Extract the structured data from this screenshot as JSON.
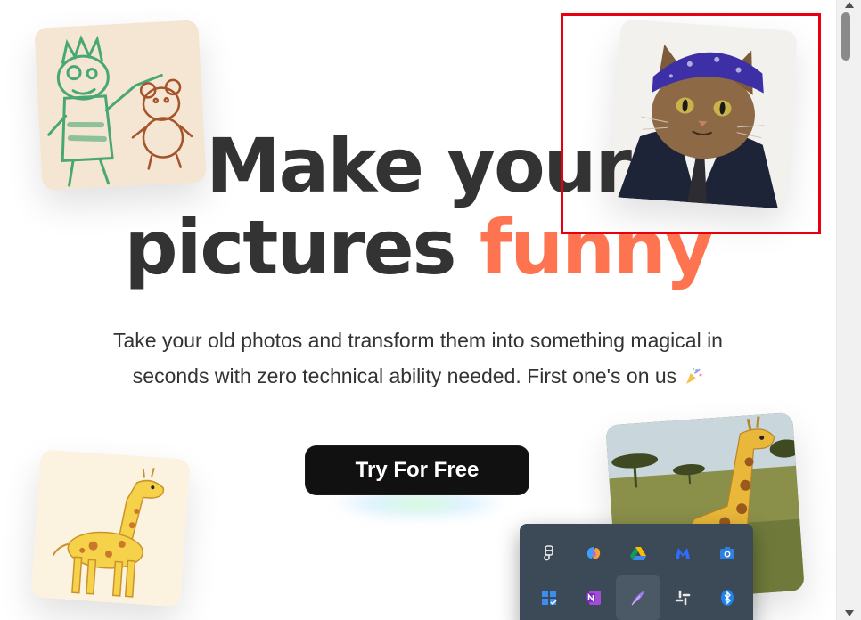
{
  "hero": {
    "line1": "Make your",
    "line2_plain": "pictures",
    "line2_accent": "funny",
    "subtitle_line1": "Take your old photos and transform them into something magical in",
    "subtitle_line2": "seconds with zero technical ability needed. First one's on us",
    "cta_label": "Try For Free"
  },
  "colors": {
    "accent": "#ff7450",
    "headline": "#333333",
    "cta_bg": "#111111",
    "highlight": "#e8000f",
    "tray_bg": "#3c4a57"
  },
  "images": {
    "kid_drawing": "child-crayon-monster-and-teddy-bear",
    "cat_photo": "cat-in-bandana-and-suit",
    "giraffe_drawing": "child-drawing-of-giraffe",
    "giraffe_photo": "toy-giraffe-in-savanna"
  },
  "tray": {
    "icons": [
      "figma-icon",
      "copilot-icon",
      "google-drive-icon",
      "malwarebytes-icon",
      "camera-app-icon",
      "calendar-grid-icon",
      "onenote-icon",
      "feather-pen-icon",
      "slack-icon",
      "bluetooth-icon"
    ]
  }
}
